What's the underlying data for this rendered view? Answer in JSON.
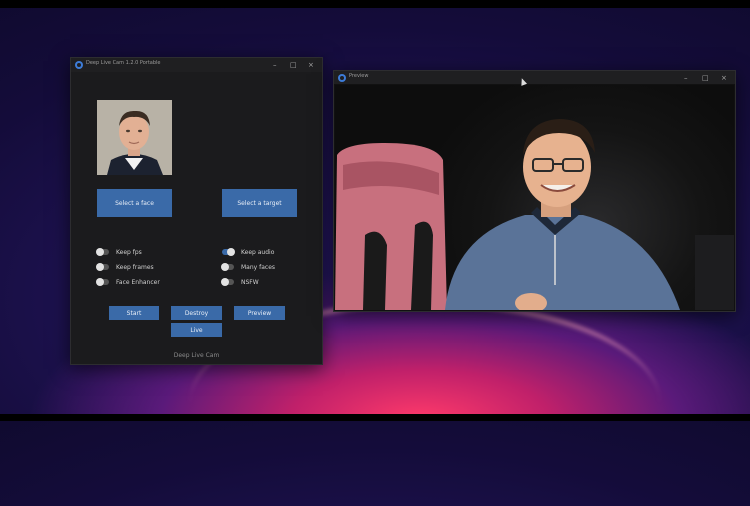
{
  "main_window": {
    "title": "Deep Live Cam 1.2.0 Portable",
    "controls": {
      "minimize": "–",
      "maximize": "□",
      "close": "×"
    },
    "buttons": {
      "select_face": "Select a face",
      "select_target": "Select a target",
      "start": "Start",
      "destroy": "Destroy",
      "preview": "Preview",
      "live": "Live"
    },
    "toggles": [
      {
        "label": "Keep fps",
        "on": false
      },
      {
        "label": "Keep frames",
        "on": false
      },
      {
        "label": "Face Enhancer",
        "on": false
      },
      {
        "label": "Keep audio",
        "on": true
      },
      {
        "label": "Many faces",
        "on": false
      },
      {
        "label": "NSFW",
        "on": false
      }
    ],
    "footer": "Deep Live Cam"
  },
  "preview_window": {
    "title": "Preview",
    "controls": {
      "minimize": "–",
      "maximize": "□",
      "close": "×"
    }
  },
  "colors": {
    "accent": "#3a6aa8",
    "window_bg": "#1b1b1d",
    "titlebar": "#1f1f21"
  }
}
